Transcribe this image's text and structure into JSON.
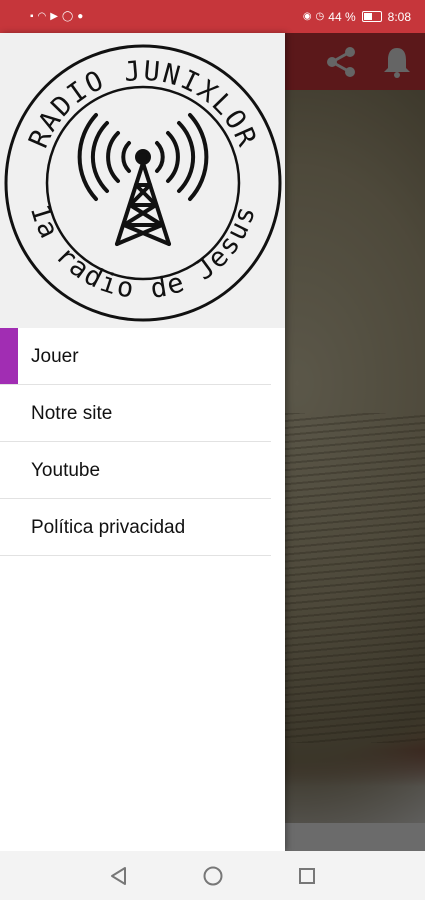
{
  "status_bar": {
    "battery_percent": "44 %",
    "battery_level": 0.44,
    "time": "8:08",
    "left_icons": [
      "sim-icon",
      "wifi-icon",
      "play-store-icon",
      "whatsapp-icon",
      "location-icon"
    ],
    "right_icons": [
      "eye-icon",
      "alarm-icon",
      "battery-icon"
    ]
  },
  "app": {
    "toolbar_color": "#d8393f",
    "actions": [
      "share-icon",
      "bell-icon"
    ]
  },
  "drawer": {
    "logo": {
      "top_text": "RADIO JUNIXLOR",
      "bottom_text": "1a radio de Jesus"
    },
    "items": [
      {
        "label": "Jouer",
        "active": true
      },
      {
        "label": "Notre site",
        "active": false
      },
      {
        "label": "Youtube",
        "active": false
      },
      {
        "label": "Política privacidad",
        "active": false
      }
    ],
    "accent": "#a12db3"
  },
  "nav_bar": {
    "buttons": [
      "back-icon",
      "home-icon",
      "recents-icon"
    ]
  }
}
